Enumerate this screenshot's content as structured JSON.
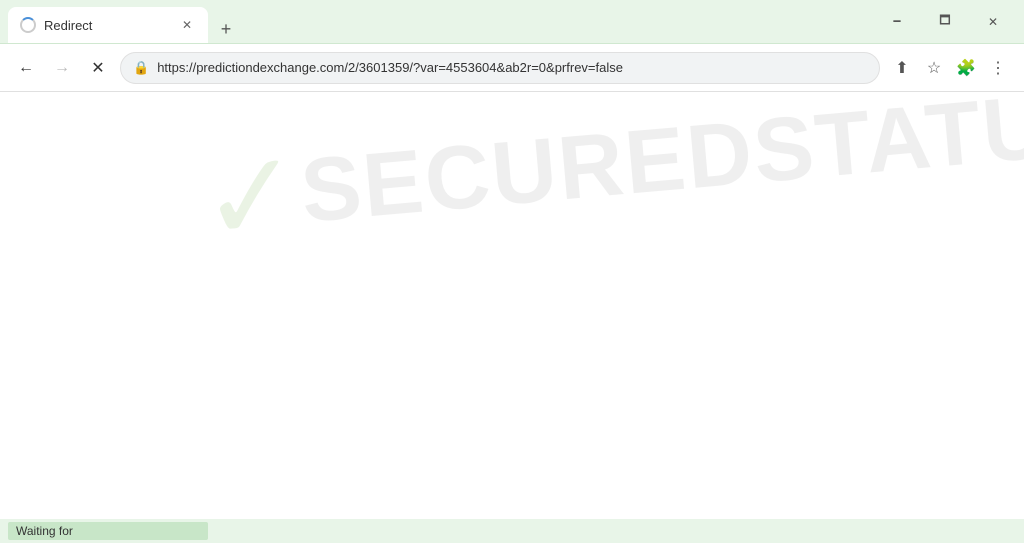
{
  "titlebar": {
    "tab_title": "Redirect",
    "new_tab_label": "+",
    "close_label": "✕",
    "minimize_label": "🗕",
    "maximize_label": "🗖",
    "window_close_label": "✕"
  },
  "navbar": {
    "back_label": "←",
    "forward_label": "→",
    "reload_label": "✕",
    "url": "https://predictiondexchange.com/2/3601359/?var=4553604&ab2r=0&prfrev=false",
    "lock_icon": "🔒",
    "share_label": "⬆",
    "bookmark_label": "☆",
    "extensions_label": "🧩",
    "menu_label": "⋮"
  },
  "watermark": {
    "check": "✓",
    "text": "SECUREDSTATUS"
  },
  "statusbar": {
    "text": "Waiting for"
  }
}
